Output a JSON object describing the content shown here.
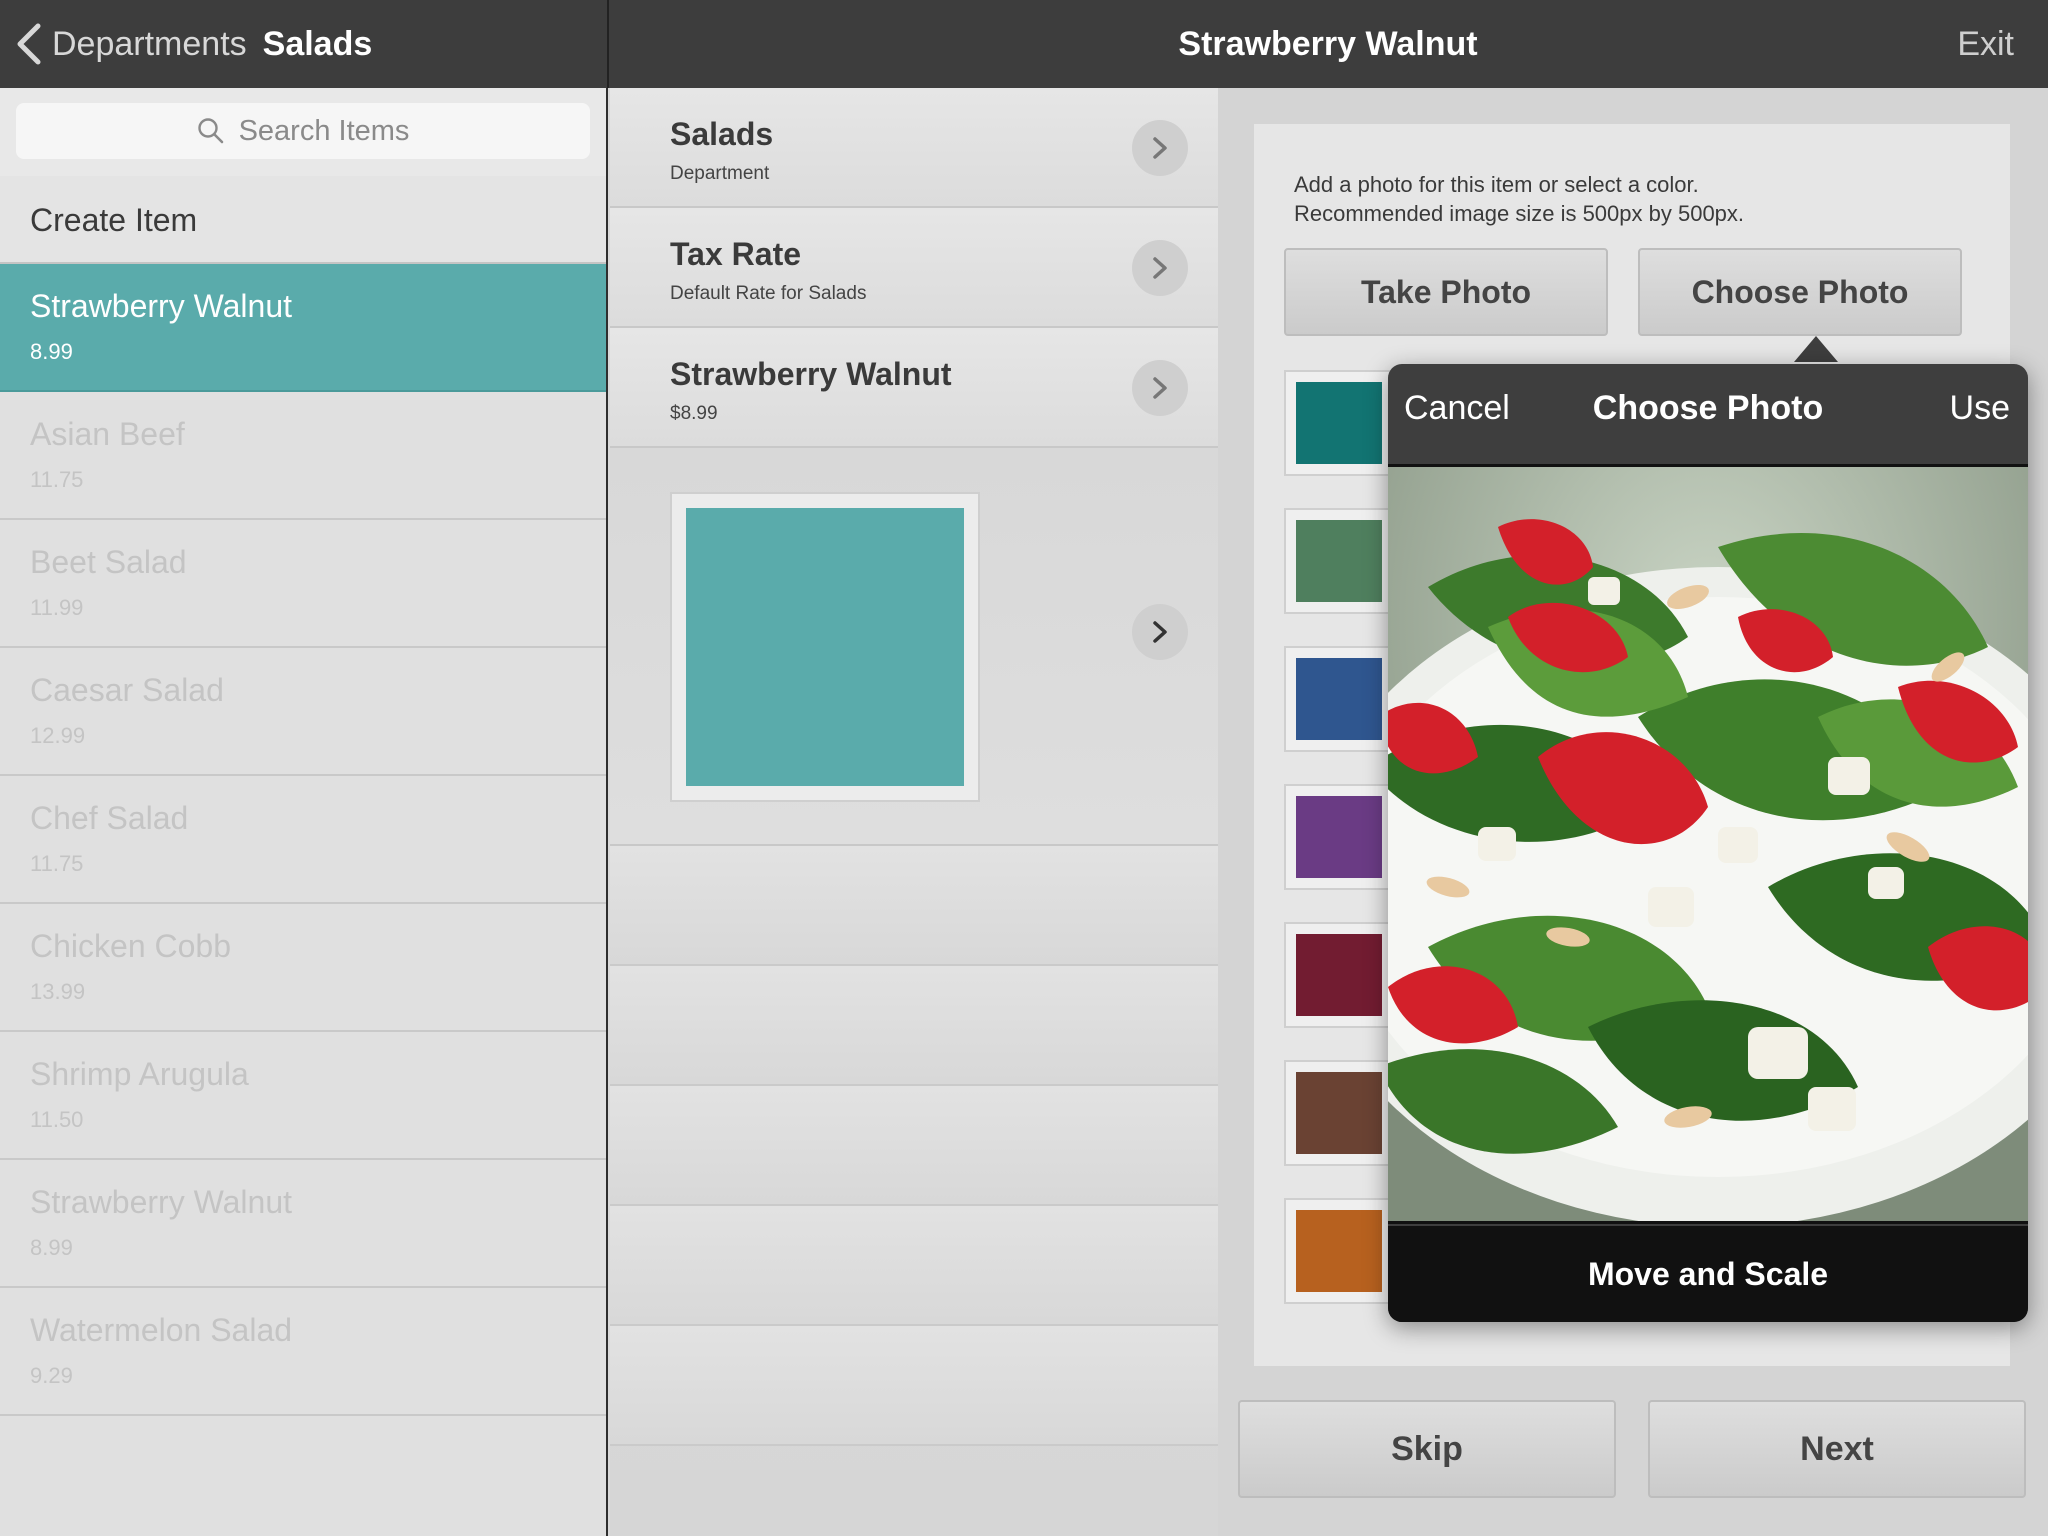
{
  "topbar": {
    "back_label": "Departments",
    "department": "Salads",
    "title": "Strawberry Walnut",
    "exit_label": "Exit"
  },
  "left": {
    "search_placeholder": "Search Items",
    "create_label": "Create Item",
    "items": [
      {
        "name": "Strawberry Walnut",
        "price": "8.99",
        "selected": true
      },
      {
        "name": "Asian Beef",
        "price": "11.75"
      },
      {
        "name": "Beet Salad",
        "price": "11.99"
      },
      {
        "name": "Caesar Salad",
        "price": "12.99"
      },
      {
        "name": "Chef Salad",
        "price": "11.75"
      },
      {
        "name": "Chicken Cobb",
        "price": "13.99"
      },
      {
        "name": "Shrimp Arugula",
        "price": "11.50"
      },
      {
        "name": "Strawberry Walnut",
        "price": "8.99"
      },
      {
        "name": "Watermelon Salad",
        "price": "9.29"
      }
    ]
  },
  "middle": {
    "rows": [
      {
        "title": "Salads",
        "subtitle": "Department"
      },
      {
        "title": "Tax Rate",
        "subtitle": "Default Rate for Salads"
      },
      {
        "title": "Strawberry Walnut",
        "subtitle": "$8.99"
      }
    ],
    "item_color": "#5aabab"
  },
  "right": {
    "info_line1": "Add a photo for this item or select a color.",
    "info_line2": "Recommended image size is 500px by 500px.",
    "take_photo": "Take Photo",
    "choose_photo": "Choose Photo",
    "colors": [
      "#127472",
      "#4f7f5e",
      "#2f568f",
      "#6a3b84",
      "#721c31",
      "#6a4233",
      "#b7611f"
    ],
    "skip": "Skip",
    "next": "Next"
  },
  "popover": {
    "cancel": "Cancel",
    "title": "Choose Photo",
    "use": "Use",
    "footer": "Move and Scale"
  }
}
